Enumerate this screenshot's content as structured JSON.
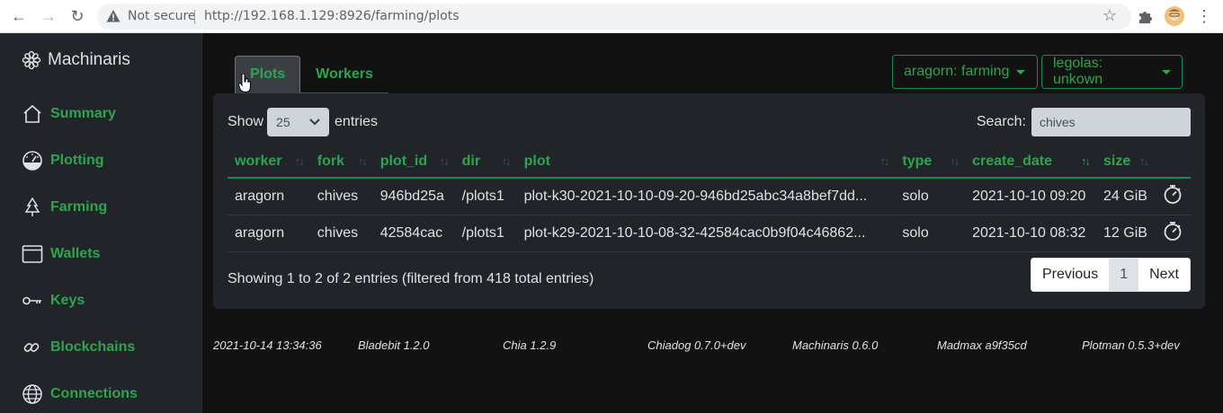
{
  "browser": {
    "security_label": "Not secure",
    "url": "http://192.168.1.129:8926/farming/plots"
  },
  "sidebar": {
    "brand": "Machinaris",
    "items": [
      {
        "label": "Summary",
        "icon": "house-icon"
      },
      {
        "label": "Plotting",
        "icon": "speedometer-icon"
      },
      {
        "label": "Farming",
        "icon": "tree-icon"
      },
      {
        "label": "Wallets",
        "icon": "wallet-icon"
      },
      {
        "label": "Keys",
        "icon": "key-icon"
      },
      {
        "label": "Blockchains",
        "icon": "link-icon"
      },
      {
        "label": "Connections",
        "icon": "globe-icon"
      }
    ]
  },
  "tabs": [
    {
      "label": "Plots",
      "active": true
    },
    {
      "label": "Workers",
      "active": false
    }
  ],
  "worker_dropdowns": [
    {
      "label": "aragorn: farming"
    },
    {
      "label": "legolas: unkown"
    }
  ],
  "table_controls": {
    "show_label": "Show",
    "page_length": "25",
    "entries_label": "entries",
    "search_label": "Search:",
    "search_value": "chives"
  },
  "table": {
    "columns": [
      "worker",
      "fork",
      "plot_id",
      "dir",
      "plot",
      "type",
      "create_date",
      "size"
    ],
    "rows": [
      [
        "aragorn",
        "chives",
        "946bd25a",
        "/plots1",
        "plot-k30-2021-10-10-09-20-946bd25abc34a8bef7dd...",
        "solo",
        "2021-10-10 09:20",
        "24 GiB"
      ],
      [
        "aragorn",
        "chives",
        "42584cac",
        "/plots1",
        "plot-k29-2021-10-10-08-32-42584cac0b9f04c46862...",
        "solo",
        "2021-10-10 08:32",
        "12 GiB"
      ]
    ],
    "row_action_icon": "stopwatch-icon"
  },
  "table_info": "Showing 1 to 2 of 2 entries (filtered from 418 total entries)",
  "pagination": {
    "previous": "Previous",
    "current": "1",
    "next": "Next"
  },
  "footer": [
    "2021-10-14 13:34:36",
    "Bladebit 1.2.0",
    "Chia 1.2.9",
    "Chiadog 0.7.0+dev",
    "Machinaris 0.6.0",
    "Madmax a9f35cd",
    "Plotman 0.5.3+dev"
  ],
  "colors": {
    "accent": "#2ea44f",
    "sidebar_bg": "#212529",
    "main_bg": "#121212",
    "card_bg": "#212529"
  }
}
